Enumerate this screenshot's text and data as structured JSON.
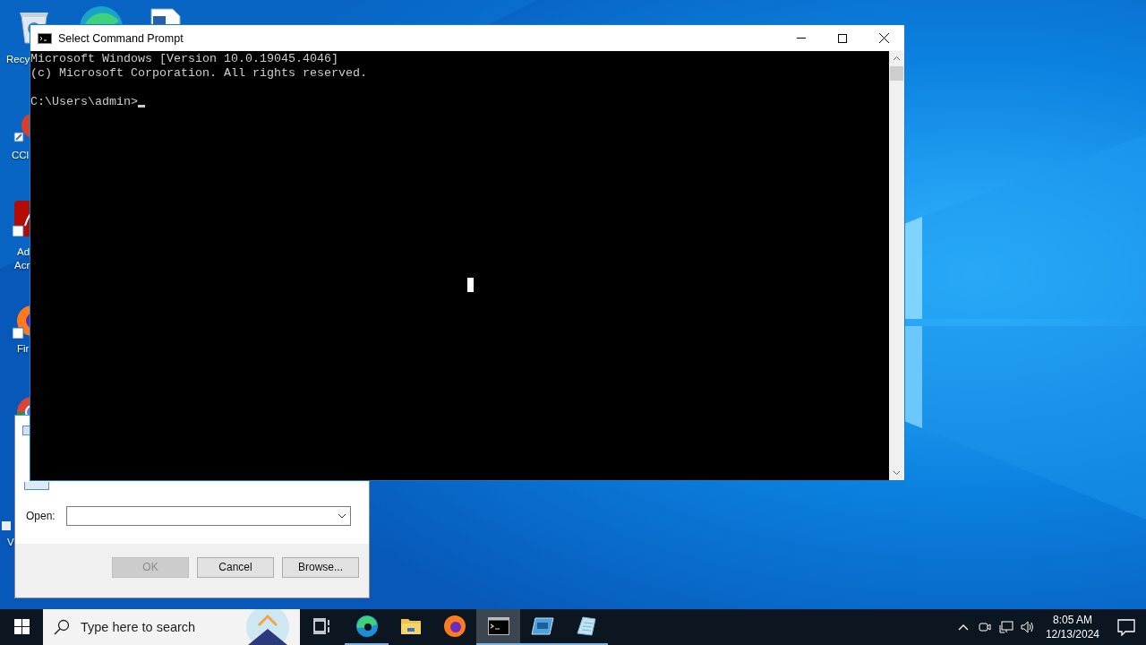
{
  "desktop_icons": [
    {
      "kind": "recycle-bin",
      "lines": [
        "Recy"
      ]
    },
    {
      "kind": "edge"
    },
    {
      "kind": "document"
    },
    {
      "kind": "cleaner",
      "lines": [
        "CCl"
      ]
    },
    {
      "kind": "acrobat",
      "lines": [
        "Ad",
        "Acr"
      ]
    },
    {
      "kind": "firefox",
      "lines": [
        "Fir"
      ]
    },
    {
      "kind": "chrome"
    },
    {
      "kind": "generic",
      "lines": [
        "V"
      ]
    }
  ],
  "run_dialog": {
    "open_label": "Open:",
    "buttons": [
      {
        "label": "OK",
        "disabled": true
      },
      {
        "label": "Cancel",
        "disabled": false
      },
      {
        "label": "Browse...",
        "disabled": false
      }
    ]
  },
  "command_prompt": {
    "title": "Select Command Prompt",
    "output": [
      "Microsoft Windows [Version 10.0.19045.4046]",
      "(c) Microsoft Corporation. All rights reserved."
    ],
    "prompt": "C:\\Users\\admin>"
  },
  "taskbar": {
    "search": {
      "placeholder": "Type here to search"
    },
    "apps": [
      {
        "kind": "task-view",
        "running": false,
        "selected": false
      },
      {
        "kind": "edge",
        "running": true,
        "selected": false
      },
      {
        "kind": "folder",
        "running": false,
        "selected": false
      },
      {
        "kind": "firefox",
        "running": false,
        "selected": false
      },
      {
        "kind": "console",
        "running": true,
        "selected": true
      },
      {
        "kind": "window-app",
        "running": true,
        "selected": false
      },
      {
        "kind": "notepad",
        "running": true,
        "selected": false
      }
    ],
    "clock": {
      "time": "8:05 AM",
      "date": "12/13/2024"
    }
  }
}
